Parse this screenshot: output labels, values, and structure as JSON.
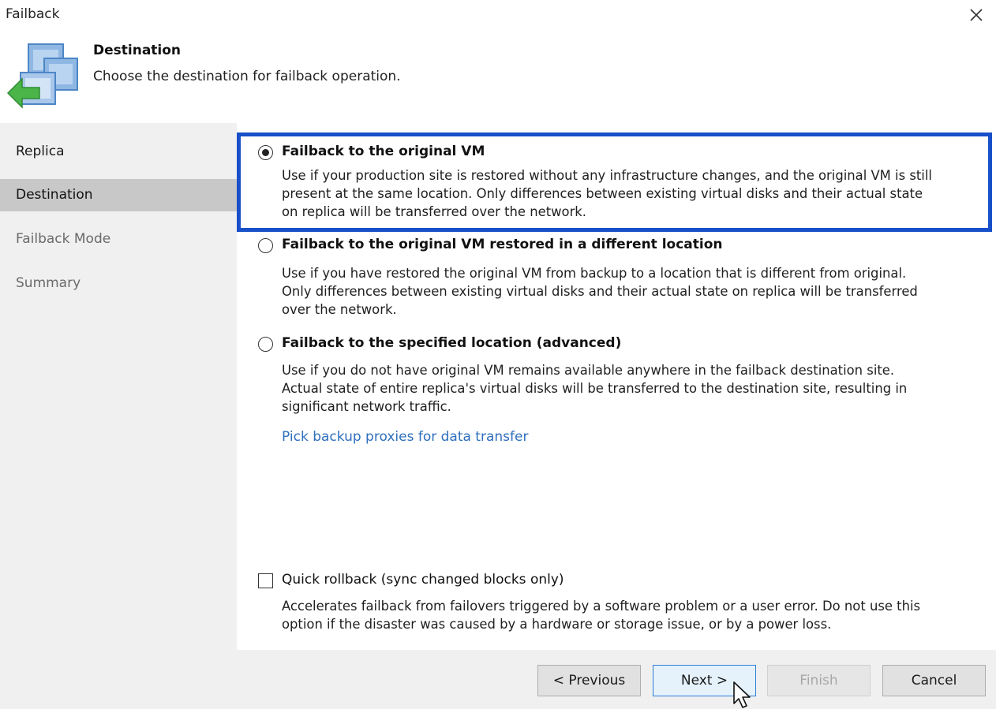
{
  "window": {
    "title": "Failback",
    "close_icon": "close-icon"
  },
  "header": {
    "title": "Destination",
    "subtitle": "Choose the destination for failback operation.",
    "icon": "failback-wizard-icon"
  },
  "sidebar": {
    "items": [
      {
        "label": "Replica",
        "state": "done"
      },
      {
        "label": "Destination",
        "state": "active"
      },
      {
        "label": "Failback Mode",
        "state": "pending"
      },
      {
        "label": "Summary",
        "state": "pending"
      }
    ]
  },
  "options": [
    {
      "label": "Failback to the original VM",
      "checked": true,
      "description": [
        "Use if your production site is restored without any infrastructure changes, and the original VM is still",
        "present at the same location. Only differences between existing virtual disks and their actual state",
        "on replica will be transferred over the network."
      ]
    },
    {
      "label": "Failback to the original VM restored in a different location",
      "checked": false,
      "description": [
        "Use if you have restored the original VM from backup to a location that is different from original.",
        "Only differences between existing virtual disks and their actual state on replica will be transferred",
        "over the network."
      ]
    },
    {
      "label": "Failback to the specified location (advanced)",
      "checked": false,
      "description": [
        "Use if you do not have original VM remains available anywhere in the failback destination site.",
        "Actual state of entire replica's virtual disks will be transferred to the destination site, resulting in",
        "significant network traffic."
      ]
    }
  ],
  "proxies_link": "Pick backup proxies for data transfer",
  "quick_rollback": {
    "label": "Quick rollback (sync changed blocks only)",
    "checked": false,
    "description": [
      "Accelerates failback from failovers triggered by a software problem or a user error. Do not use this",
      "option if the disaster was caused by a hardware or storage issue, or by a power loss."
    ]
  },
  "buttons": {
    "previous": "< Previous",
    "next": "Next >",
    "finish": "Finish",
    "cancel": "Cancel"
  },
  "colors": {
    "highlight": "#1750c8",
    "link": "#2e6fbd",
    "sidebar_active": "#c8c8c8"
  }
}
